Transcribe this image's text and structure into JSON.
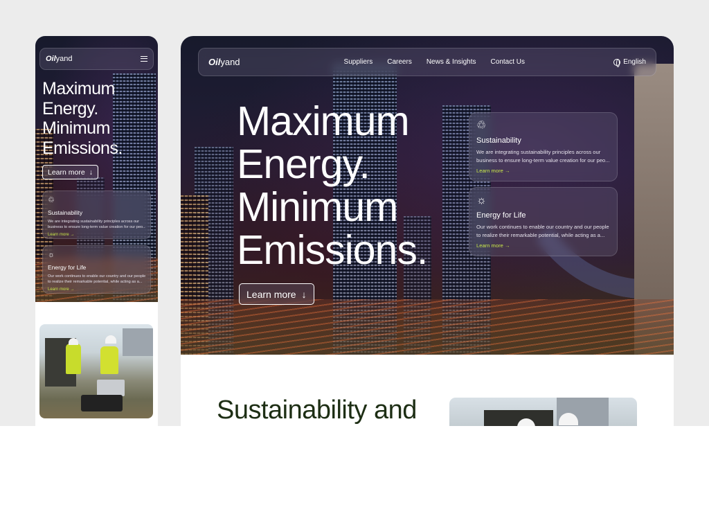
{
  "brand": {
    "logo_bold": "Oil",
    "logo_rest": "yand"
  },
  "nav": {
    "links": [
      "Suppliers",
      "Careers",
      "News & Insights",
      "Contact Us"
    ],
    "language": "English"
  },
  "hero": {
    "headline_lines": [
      "Maximum",
      "Energy.",
      "Minimum",
      "Emissions."
    ],
    "learn_more": "Learn more",
    "arrow": "↓"
  },
  "cards": [
    {
      "icon": "recycle-icon",
      "title": "Sustainability",
      "desc_line1": "We are integrating sustainability principles across our",
      "desc_line2": "business to ensure long-term value creation for our peo...",
      "link": "Learn more",
      "link_arrow": "→"
    },
    {
      "icon": "lightbulb-icon",
      "title": "Energy for Life",
      "desc_line1": "Our work continues to enable our country and our people",
      "desc_line2": "to realize their remarkable potential, while acting as a...",
      "link": "Learn more",
      "link_arrow": "→"
    }
  ],
  "section": {
    "heading": "Sustainability and"
  },
  "colors": {
    "accent": "#c8e64a",
    "heading": "#1d2e14"
  }
}
